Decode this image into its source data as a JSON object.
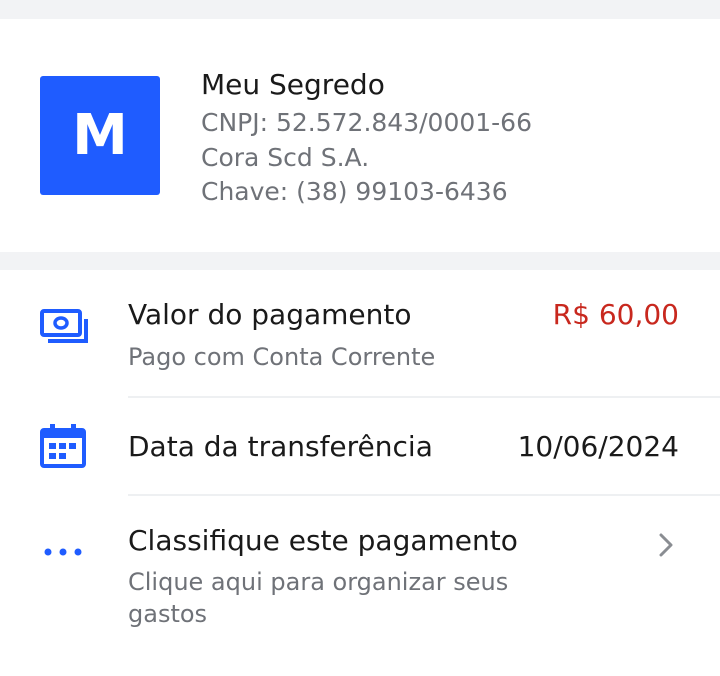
{
  "recipient": {
    "avatar_letter": "M",
    "name": "Meu Segredo",
    "cnpj": "CNPJ: 52.572.843/0001-66",
    "institution": "Cora Scd S.A.",
    "key": "Chave: (38) 99103-6436"
  },
  "payment": {
    "title": "Valor do pagamento",
    "subtitle": "Pago com Conta Corrente",
    "amount": "R$ 60,00"
  },
  "transfer_date": {
    "title": "Data da transferência",
    "value": "10/06/2024"
  },
  "classify": {
    "title": "Classifique este pagamento",
    "subtitle": "Clique aqui para organizar seus gastos"
  },
  "colors": {
    "accent": "#1f5cff",
    "amount": "#c8281e",
    "muted": "#6f7278"
  }
}
